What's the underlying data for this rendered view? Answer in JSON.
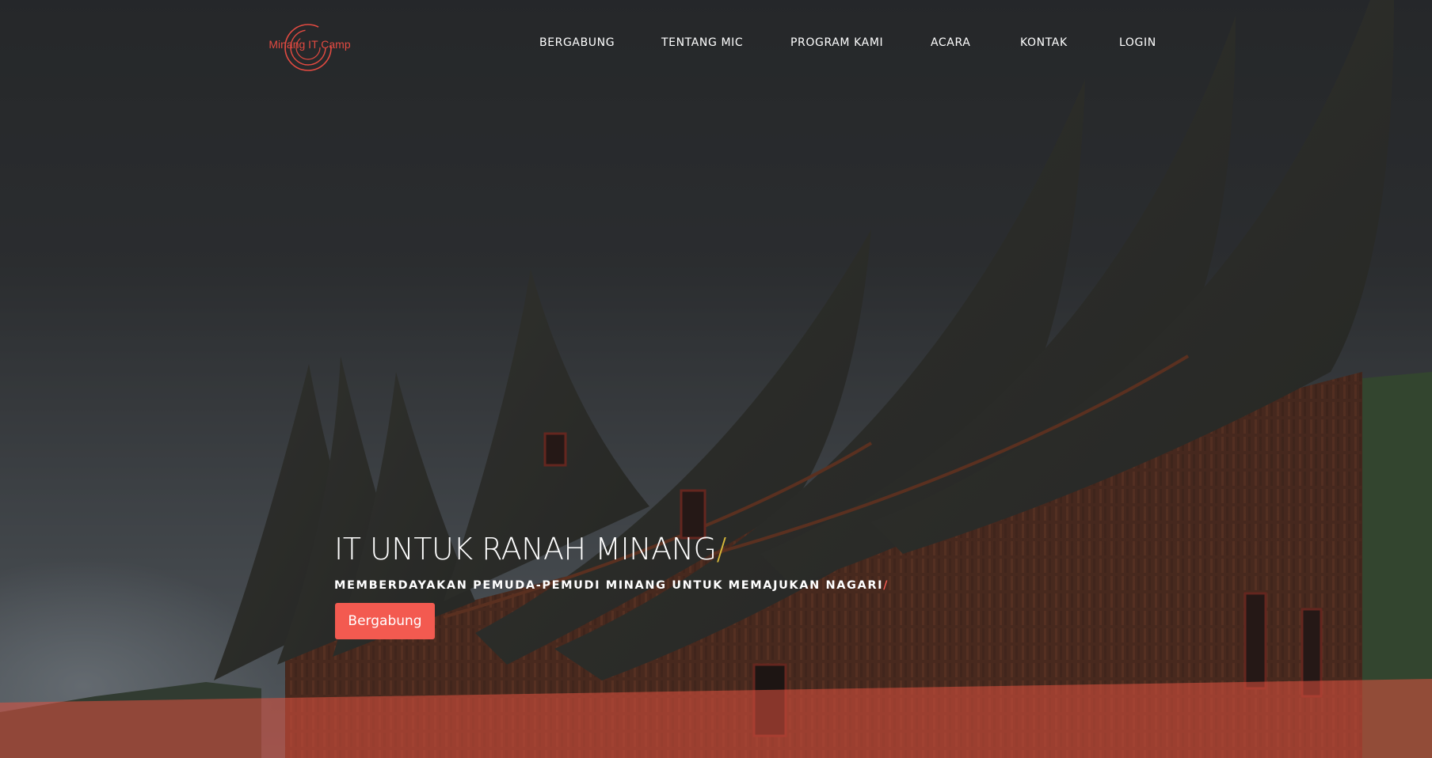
{
  "header": {
    "logo_text": "Minang IT Camp",
    "nav": [
      {
        "label": "BERGABUNG"
      },
      {
        "label": "TENTANG MIC"
      },
      {
        "label": "PROGRAM KAMI"
      },
      {
        "label": "ACARA"
      },
      {
        "label": "KONTAK"
      },
      {
        "label": "LOGIN"
      }
    ]
  },
  "hero": {
    "background": "rumah-gadang-photo",
    "title": "IT UNTUK RANAH MINANG",
    "title_slash": "/",
    "subtitle": "MEMBERDAYAKAN PEMUDA-PEMUDI MINANG UNTUK MEMAJUKAN NAGARI",
    "subtitle_slash": "/",
    "cta_label": "Bergabung"
  },
  "colors": {
    "accent": "#f35a50",
    "logo": "#e24a41",
    "title_slash": "#d8b93a"
  },
  "icons": {
    "logo": "circle-swirl-icon"
  }
}
